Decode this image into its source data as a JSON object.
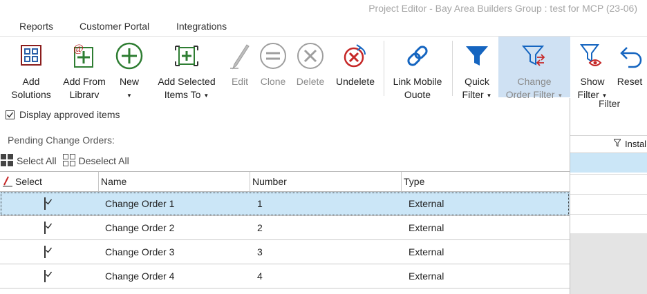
{
  "window": {
    "title": "Project Editor - Bay Area Builders Group : test for MCP (23-06)"
  },
  "tabs": [
    {
      "label": "Reports"
    },
    {
      "label": "Customer Portal"
    },
    {
      "label": "Integrations"
    }
  ],
  "ribbon": {
    "add_solutions": {
      "line1": "Add",
      "line2": "Solutions"
    },
    "add_from_library": {
      "line1": "Add From",
      "line2": "Library"
    },
    "new": {
      "line1": "New"
    },
    "add_selected_items": {
      "line1": "Add Selected",
      "line2": "Items To"
    },
    "edit": {
      "line1": "Edit"
    },
    "clone": {
      "line1": "Clone"
    },
    "delete": {
      "line1": "Delete"
    },
    "undelete": {
      "line1": "Undelete"
    },
    "link_mobile_quote": {
      "line1": "Link Mobile",
      "line2": "Quote"
    },
    "quick_filter": {
      "line1": "Quick",
      "line2": "Filter"
    },
    "change_order_filter": {
      "line1": "Change",
      "line2": "Order Filter"
    },
    "show_filter": {
      "line1": "Show",
      "line2": "Filter"
    },
    "reset": {
      "line1": "Reset"
    },
    "filter_group_label": "Filter"
  },
  "background_grid": {
    "column_header": "Instal"
  },
  "panel": {
    "display_approved_label": "Display approved items",
    "display_approved_checked": true,
    "pending_label": "Pending Change Orders:",
    "select_all": "Select All",
    "deselect_all": "Deselect All",
    "columns": [
      "Select",
      "Name",
      "Number",
      "Type"
    ],
    "rows": [
      {
        "checked": true,
        "name": "Change Order 1",
        "number": "1",
        "type": "External",
        "selected": true
      },
      {
        "checked": true,
        "name": "Change Order 2",
        "number": "2",
        "type": "External",
        "selected": false
      },
      {
        "checked": true,
        "name": "Change Order 3",
        "number": "3",
        "type": "External",
        "selected": false
      },
      {
        "checked": true,
        "name": "Change Order 4",
        "number": "4",
        "type": "External",
        "selected": false
      }
    ]
  }
}
